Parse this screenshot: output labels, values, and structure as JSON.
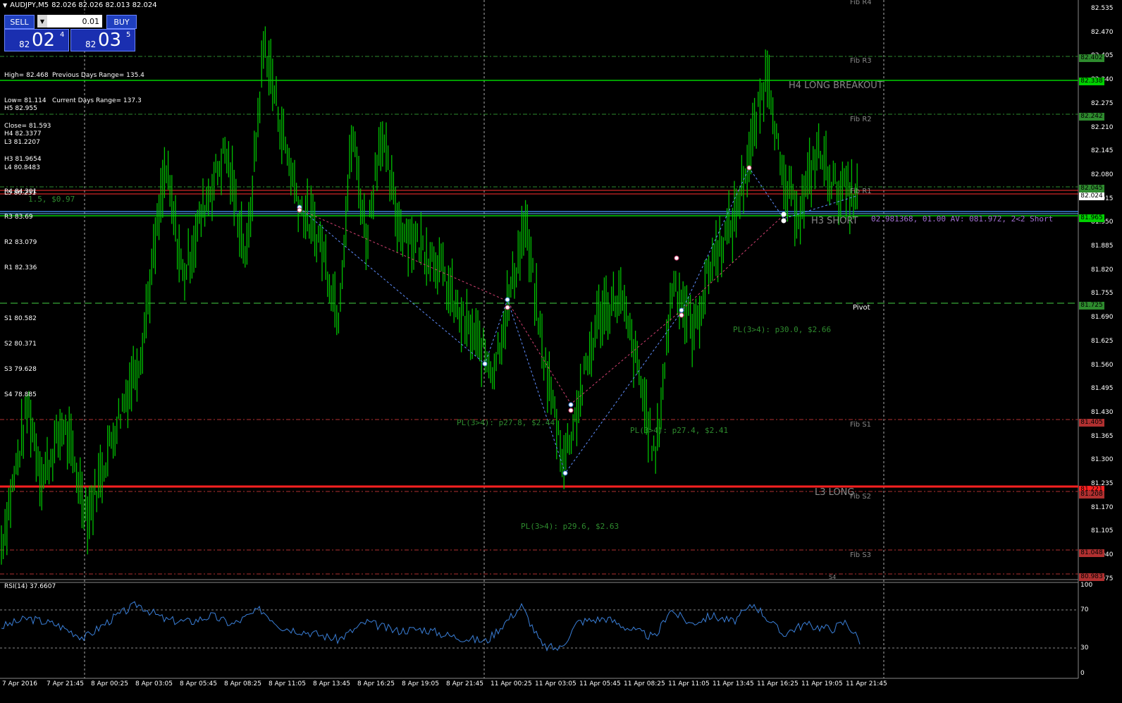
{
  "window": {
    "symbol": "AUDJPY,M5",
    "ohlc": "82.026 82.026 82.013 82.024"
  },
  "trade_panel": {
    "sell_label": "SELL",
    "buy_label": "BUY",
    "lot": "0.01",
    "sell_price": {
      "small": "82",
      "big": "02",
      "sup": "4"
    },
    "buy_price": {
      "small": "82",
      "big": "03",
      "sup": "5"
    }
  },
  "stats": {
    "high": "High= 82.468",
    "low": "Low= 81.114",
    "close": "Close= 81.593",
    "prev_range": "Previous Days Range= 135.4",
    "curr_range": "Current Days Range= 137.3"
  },
  "camarilla": {
    "h5": "H5 82.955",
    "h4": "H4 82.3377",
    "h3": "H3 81.9654",
    "l3": "L3 81.2207",
    "l4": "L4 80.8483",
    "l5": "L5 80.231"
  },
  "pivots": {
    "r4": "R4 84.301",
    "r3": "R3 83.69",
    "r2": "R2 83.079",
    "r1": "R1 82.336",
    "s1": "S1 80.582",
    "s2": "S2 80.371",
    "s3": "S3 79.628",
    "s4": "S4 78.885",
    "overlay": "1.5, $0.97"
  },
  "fib_labels": {
    "r4": "Fib R4",
    "r3": "Fib R3",
    "r2": "Fib R2",
    "r1": "Fib R1",
    "pivot": "Pivot",
    "s1": "Fib S1",
    "s2": "Fib S2",
    "s3": "Fib S3",
    "s4": "S4"
  },
  "annotations": {
    "h4_long": "H4 LONG BREAKOUT",
    "h3_short": "H3 SHORT",
    "l3_long": "L3 LONG",
    "position": "02.981368, 01.00 AV: 081.972, 2<2 Short",
    "pl1": "PL(3>4): p27.8, $2.44",
    "pl2": "PL(3>4): p29.6, $2.63",
    "pl3": "PL(3>4): p27.4, $2.41",
    "pl4": "PL(3>4): p30.0, $2.66"
  },
  "price_axis": [
    "82.535",
    "82.470",
    "82.405",
    "82.340",
    "82.275",
    "82.210",
    "82.145",
    "82.080",
    "82.015",
    "81.950",
    "81.885",
    "81.820",
    "81.755",
    "81.690",
    "81.625",
    "81.560",
    "81.495",
    "81.430",
    "81.365",
    "81.300",
    "81.235",
    "81.170",
    "81.105",
    "81.040",
    "80.975"
  ],
  "price_tags": [
    {
      "value": "82.402",
      "color": "#2e8b2e"
    },
    {
      "value": "82.338",
      "color": "#00d000"
    },
    {
      "value": "82.242",
      "color": "#2e8b2e"
    },
    {
      "value": "82.045",
      "color": "#2e8b2e"
    },
    {
      "value": "82.024",
      "color": "#ffffff"
    },
    {
      "value": "81.965",
      "color": "#00d000"
    },
    {
      "value": "81.725",
      "color": "#2e8b2e"
    },
    {
      "value": "81.405",
      "color": "#b03030"
    },
    {
      "value": "81.221",
      "color": "#ff2020"
    },
    {
      "value": "81.208",
      "color": "#b03030"
    },
    {
      "value": "81.048",
      "color": "#b03030"
    },
    {
      "value": "80.983",
      "color": "#b03030"
    }
  ],
  "rsi": {
    "label": "RSI(14) 37.6607",
    "levels": [
      "100",
      "70",
      "30",
      "0"
    ]
  },
  "time_axis": [
    "7 Apr 2016",
    "7 Apr 21:45",
    "8 Apr 00:25",
    "8 Apr 03:05",
    "8 Apr 05:45",
    "8 Apr 08:25",
    "8 Apr 11:05",
    "8 Apr 13:45",
    "8 Apr 16:25",
    "8 Apr 19:05",
    "8 Apr 21:45",
    "11 Apr 00:25",
    "11 Apr 03:05",
    "11 Apr 05:45",
    "11 Apr 08:25",
    "11 Apr 11:05",
    "11 Apr 13:45",
    "11 Apr 16:25",
    "11 Apr 19:05",
    "11 Apr 21:45"
  ],
  "colors": {
    "candle": "#00c000",
    "rsi_line": "#3a7fd8",
    "resistance": "#ff2020",
    "support_green": "#00d000",
    "pivot_dash": "#2e8b2e"
  },
  "chart_data": {
    "type": "bar",
    "title": "AUDJPY,M5",
    "ylim": [
      80.95,
      82.56
    ],
    "price_path": [
      [
        0,
        81.05
      ],
      [
        40,
        81.45
      ],
      [
        60,
        81.25
      ],
      [
        90,
        81.4
      ],
      [
        125,
        81.15
      ],
      [
        165,
        81.4
      ],
      [
        200,
        81.6
      ],
      [
        235,
        82.1
      ],
      [
        260,
        81.8
      ],
      [
        290,
        82.0
      ],
      [
        320,
        82.15
      ],
      [
        350,
        81.85
      ],
      [
        375,
        82.45
      ],
      [
        400,
        82.2
      ],
      [
        425,
        82.0
      ],
      [
        455,
        81.9
      ],
      [
        480,
        81.7
      ],
      [
        500,
        82.2
      ],
      [
        520,
        81.9
      ],
      [
        540,
        82.2
      ],
      [
        565,
        81.95
      ],
      [
        590,
        81.9
      ],
      [
        620,
        81.85
      ],
      [
        650,
        81.7
      ],
      [
        685,
        81.6
      ],
      [
        700,
        81.55
      ],
      [
        720,
        81.72
      ],
      [
        745,
        81.95
      ],
      [
        770,
        81.6
      ],
      [
        800,
        81.3
      ],
      [
        820,
        81.45
      ],
      [
        850,
        81.7
      ],
      [
        880,
        81.75
      ],
      [
        905,
        81.55
      ],
      [
        930,
        81.3
      ],
      [
        955,
        81.8
      ],
      [
        985,
        81.65
      ],
      [
        1010,
        81.85
      ],
      [
        1040,
        81.95
      ],
      [
        1065,
        82.15
      ],
      [
        1090,
        82.38
      ],
      [
        1110,
        82.05
      ],
      [
        1135,
        81.98
      ],
      [
        1160,
        82.15
      ],
      [
        1185,
        82.05
      ],
      [
        1215,
        82.02
      ]
    ],
    "rsi_path": [
      [
        0,
        52
      ],
      [
        40,
        62
      ],
      [
        80,
        55
      ],
      [
        120,
        40
      ],
      [
        160,
        62
      ],
      [
        195,
        78
      ],
      [
        235,
        60
      ],
      [
        270,
        58
      ],
      [
        300,
        65
      ],
      [
        330,
        55
      ],
      [
        370,
        72
      ],
      [
        400,
        52
      ],
      [
        440,
        46
      ],
      [
        480,
        38
      ],
      [
        520,
        58
      ],
      [
        560,
        48
      ],
      [
        600,
        50
      ],
      [
        640,
        42
      ],
      [
        690,
        36
      ],
      [
        710,
        52
      ],
      [
        740,
        76
      ],
      [
        770,
        30
      ],
      [
        795,
        28
      ],
      [
        820,
        58
      ],
      [
        860,
        62
      ],
      [
        900,
        48
      ],
      [
        930,
        40
      ],
      [
        950,
        72
      ],
      [
        980,
        56
      ],
      [
        1010,
        65
      ],
      [
        1040,
        58
      ],
      [
        1070,
        78
      ],
      [
        1110,
        44
      ],
      [
        1140,
        55
      ],
      [
        1180,
        50
      ],
      [
        1200,
        58
      ],
      [
        1220,
        37
      ]
    ]
  }
}
